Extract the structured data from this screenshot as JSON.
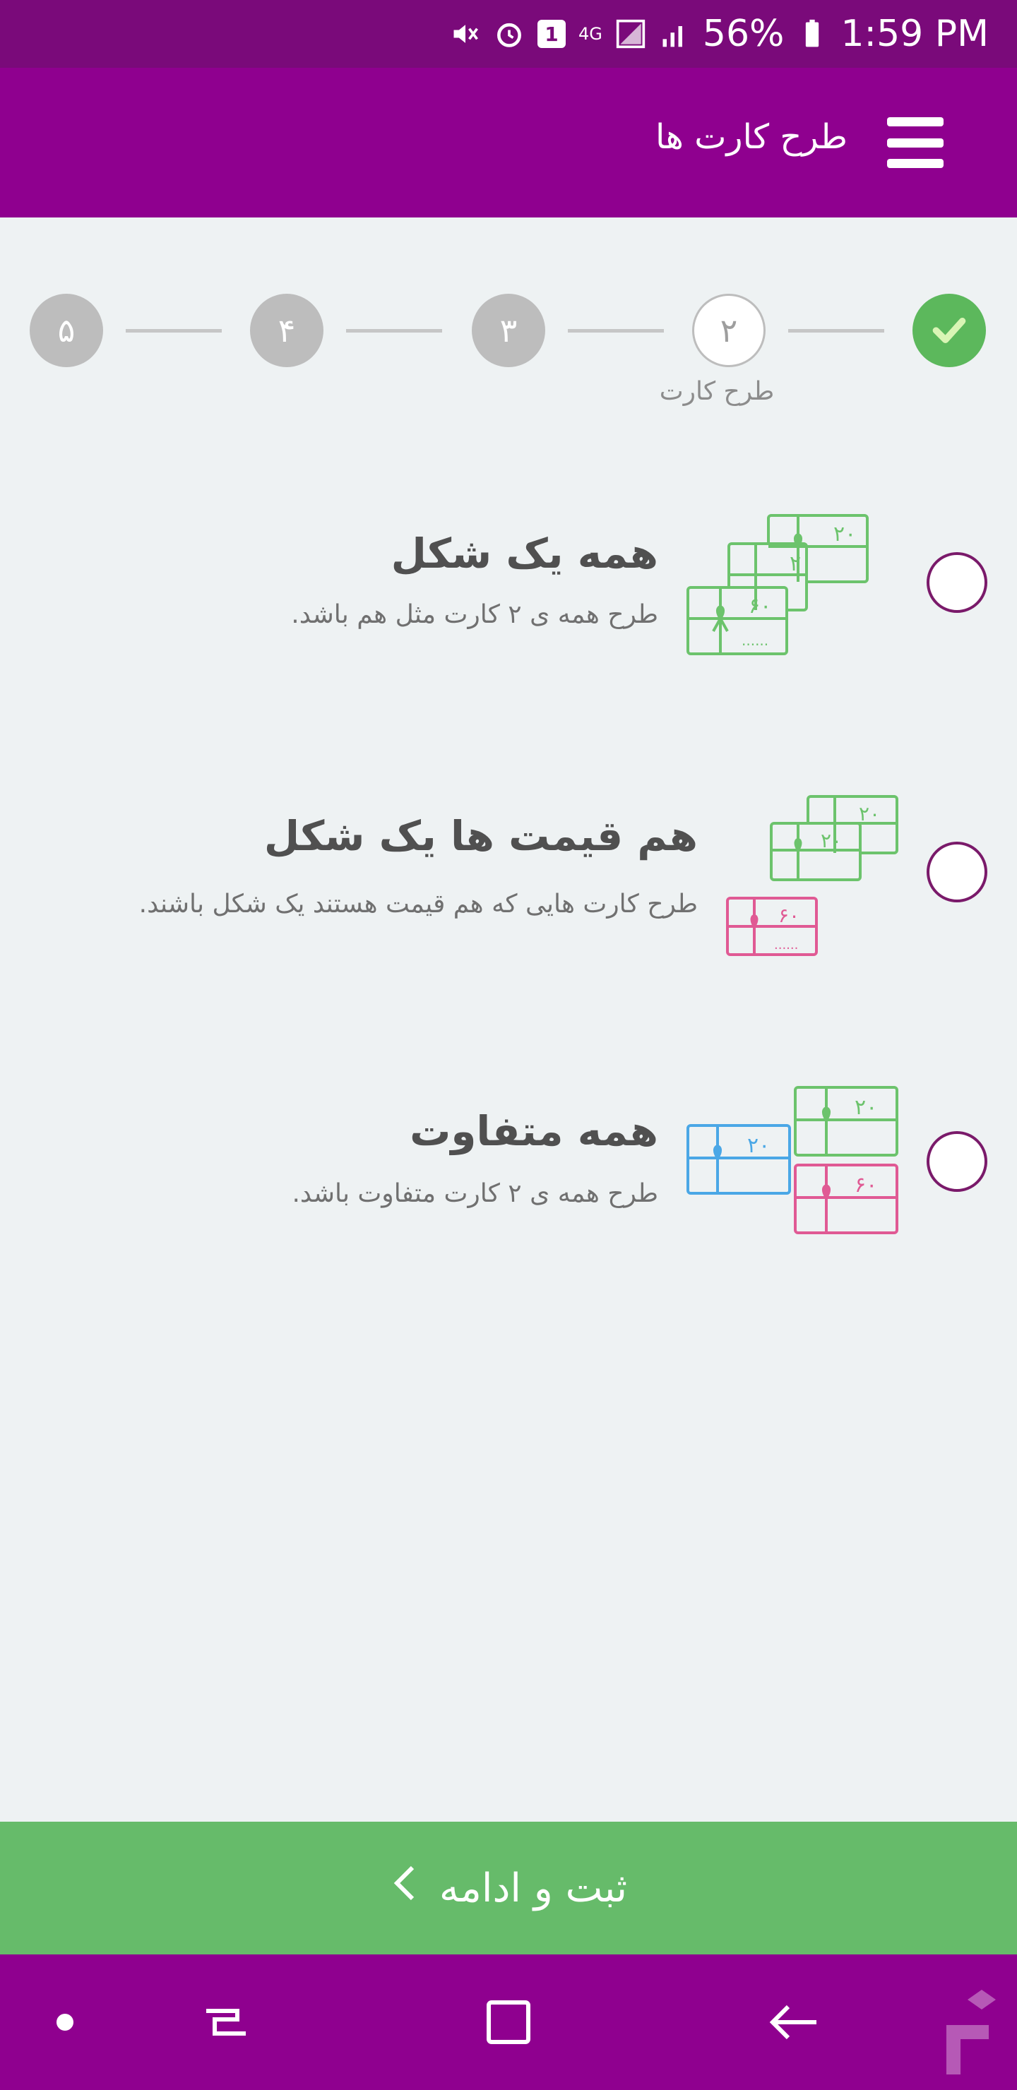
{
  "status_bar": {
    "time": "1:59 PM",
    "battery": "56%",
    "network": "4G",
    "sim_badge": "1",
    "icons": [
      "mute-icon",
      "alarm-icon",
      "sim-icon",
      "network-4g-icon",
      "signal-icon",
      "signal-icon-2",
      "battery-icon"
    ]
  },
  "app_bar": {
    "title": "طرح کارت ها",
    "menu_icon": "hamburger-menu-icon"
  },
  "stepper": {
    "steps": [
      {
        "label": "۵",
        "state": "pending"
      },
      {
        "label": "۴",
        "state": "pending"
      },
      {
        "label": "۳",
        "state": "pending"
      },
      {
        "label": "۲",
        "state": "current"
      },
      {
        "label": "",
        "state": "done",
        "icon": "check-icon"
      }
    ],
    "current_caption": "طرح کارت"
  },
  "options": [
    {
      "title": "همه یک شکل",
      "description": "طرح همه ی ۲ کارت مثل هم باشد.",
      "selected": false,
      "cards": [
        {
          "value": "۲۰",
          "color": "#6cc36c"
        },
        {
          "value": "۲۰",
          "color": "#6cc36c"
        },
        {
          "value": "۶۰",
          "color": "#6cc36c"
        }
      ]
    },
    {
      "title": "هم قیمت ها یک شکل",
      "description": "طرح کارت هایی که هم قیمت هستند یک شکل باشند.",
      "selected": false,
      "cards": [
        {
          "value": "۲۰",
          "color": "#6cc36c"
        },
        {
          "value": "۲۰",
          "color": "#6cc36c"
        },
        {
          "value": "۶۰",
          "color": "#e05a94"
        }
      ]
    },
    {
      "title": "همه متفاوت",
      "description": "طرح همه ی ۲ کارت متفاوت باشد.",
      "selected": false,
      "cards": [
        {
          "value": "۲۰",
          "color": "#6cc36c"
        },
        {
          "value": "۲۰",
          "color": "#4aa7e6"
        },
        {
          "value": "۶۰",
          "color": "#e05a94"
        }
      ]
    }
  ],
  "continue_button": {
    "label": "ثبت و ادامه",
    "icon": "chevron-left-icon"
  },
  "nav_bar": {
    "icons": [
      "dot-icon",
      "recent-apps-icon",
      "home-icon",
      "back-icon"
    ]
  },
  "colors": {
    "status_bar": "#7a0a7a",
    "app_bar": "#8f008f",
    "accent_green": "#66bb6a",
    "background": "#eef2f3"
  }
}
